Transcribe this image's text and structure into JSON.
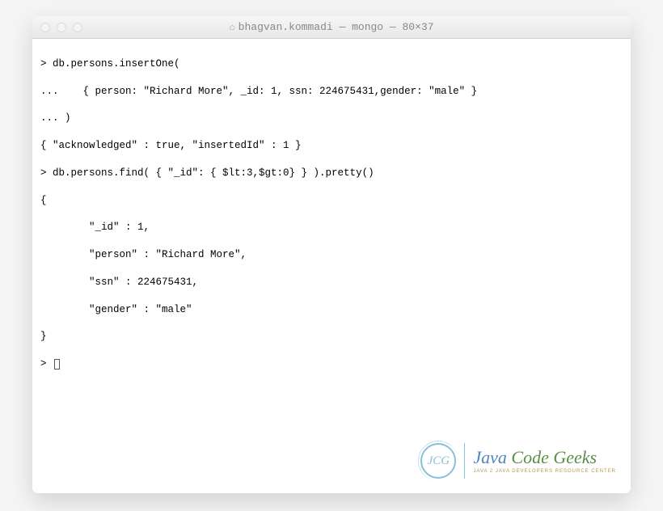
{
  "window": {
    "title": "bhagvan.kommadi — mongo — 80×37"
  },
  "terminal": {
    "lines": [
      "> db.persons.insertOne(",
      "...    { person: \"Richard More\", _id: 1, ssn: 224675431,gender: \"male\" }",
      "... )",
      "{ \"acknowledged\" : true, \"insertedId\" : 1 }",
      "> db.persons.find( { \"_id\": { $lt:3,$gt:0} } ).pretty()",
      "{",
      "        \"_id\" : 1,",
      "        \"person\" : \"Richard More\",",
      "        \"ssn\" : 224675431,",
      "        \"gender\" : \"male\"",
      "}",
      "> "
    ],
    "prompt": ">"
  },
  "watermark": {
    "badge": "JCG",
    "brand_java": "Java ",
    "brand_rest": "Code Geeks",
    "tagline": "JAVA 2 JAVA DEVELOPERS RESOURCE CENTER"
  }
}
